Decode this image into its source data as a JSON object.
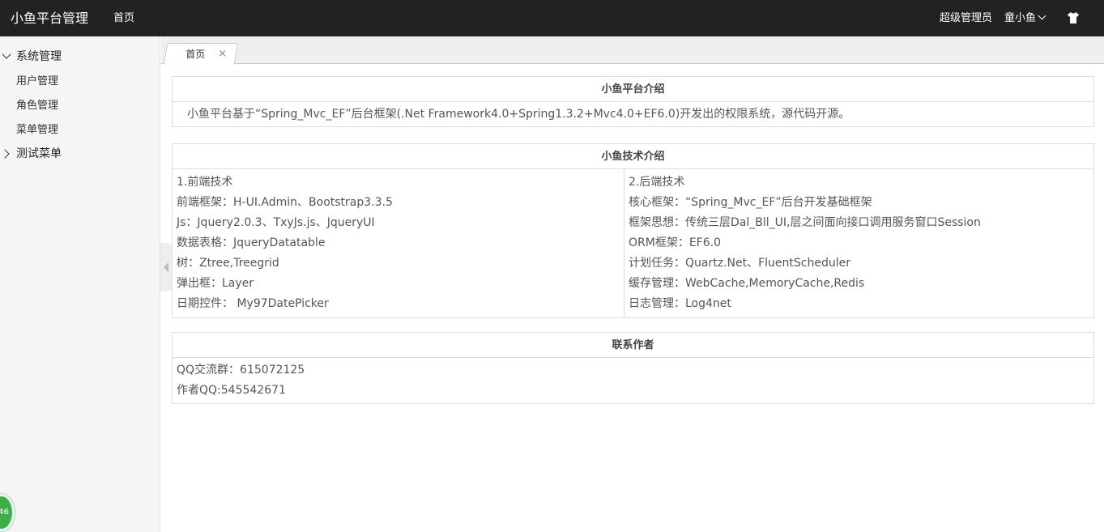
{
  "header": {
    "brand": "小鱼平台管理",
    "nav_home": "首页",
    "user_role": "超级管理员",
    "user_name": "童小鱼"
  },
  "sidebar": {
    "groups": [
      {
        "label": "系统管理",
        "expanded": true,
        "items": [
          "用户管理",
          "角色管理",
          "菜单管理"
        ]
      },
      {
        "label": "测试菜单",
        "expanded": false,
        "items": []
      }
    ],
    "badge": "46"
  },
  "tabs": [
    {
      "label": "首页",
      "close": "×"
    }
  ],
  "panels": {
    "intro": {
      "title": "小鱼平台介绍",
      "text": "小鱼平台基于“Spring_Mvc_EF”后台框架(.Net Framework4.0+Spring1.3.2+Mvc4.0+EF6.0)开发出的权限系统，源代码开源。"
    },
    "tech": {
      "title": "小鱼技术介绍",
      "frontend": [
        "1.前端技术",
        "前端框架：H-UI.Admin、Bootstrap3.3.5",
        "Js：Jquery2.0.3、TxyJs.js、JqueryUI",
        "数据表格：JqueryDatatable",
        "树：Ztree,Treegrid",
        "弹出框：Layer",
        "日期控件： My97DatePicker"
      ],
      "backend": [
        "2.后端技术",
        "核心框架：“Spring_Mvc_EF”后台开发基础框架",
        "框架思想：传统三层Dal_Bll_UI,层之间面向接口调用服务窗口Session",
        "ORM框架：EF6.0",
        "计划任务：Quartz.Net、FluentScheduler",
        "缓存管理：WebCache,MemoryCache,Redis",
        "日志管理：Log4net"
      ]
    },
    "contact": {
      "title": "联系作者",
      "lines": [
        "QQ交流群：615072125",
        "作者QQ:545542671"
      ]
    }
  }
}
